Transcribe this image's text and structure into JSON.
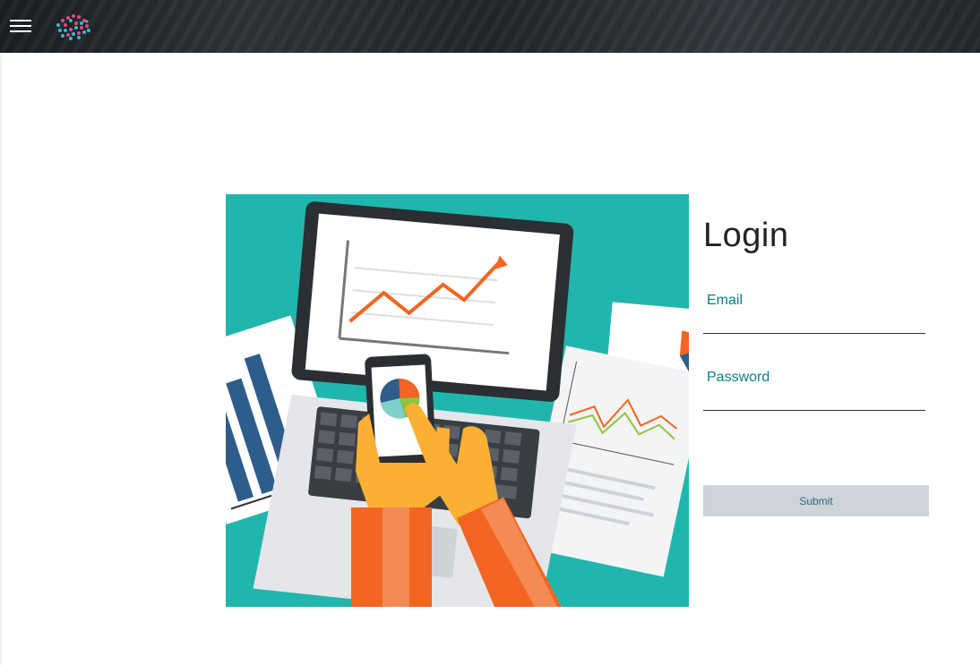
{
  "header": {
    "menu_icon": "hamburger-menu-icon",
    "logo_icon": "dotted-network-logo"
  },
  "hero": {
    "image": "illustration-laptop-analytics-charts-hand-with-phone"
  },
  "login": {
    "title": "Login",
    "email_label": "Email",
    "email_value": "",
    "password_label": "Password",
    "password_value": "",
    "submit_label": "Submit"
  },
  "colors": {
    "topbar": "#23282b",
    "hero_background": "#21b6ad",
    "label": "#0a7d8a",
    "submit_bg": "#ced4da",
    "orange": "#f26522",
    "yellow": "#fbb034"
  }
}
